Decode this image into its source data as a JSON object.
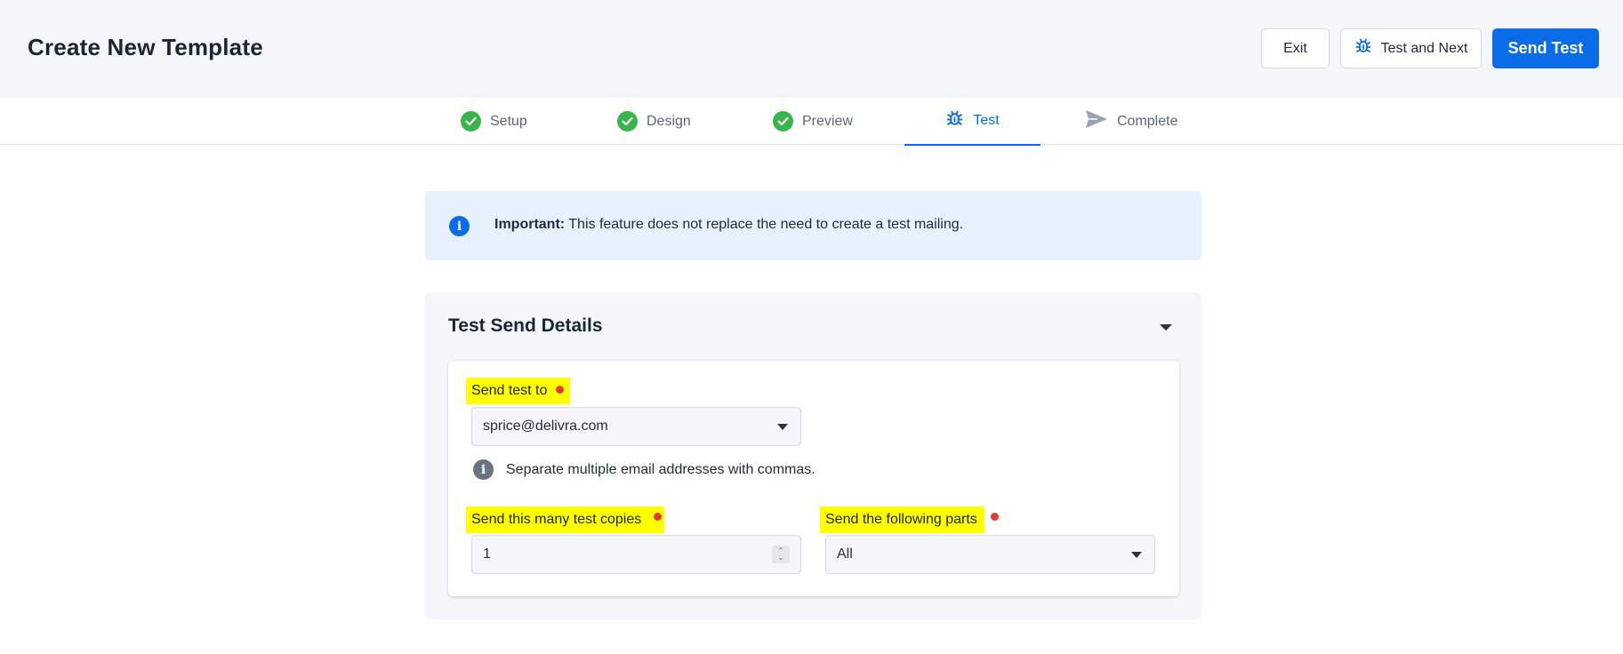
{
  "header": {
    "title": "Create New Template",
    "exit_label": "Exit",
    "test_next_label": "Test and Next",
    "send_test_label": "Send Test"
  },
  "steps": [
    {
      "label": "Setup",
      "icon": "check-circle-icon",
      "state": "complete"
    },
    {
      "label": "Design",
      "icon": "check-circle-icon",
      "state": "complete"
    },
    {
      "label": "Preview",
      "icon": "check-circle-icon",
      "state": "complete"
    },
    {
      "label": "Test",
      "icon": "bug-icon",
      "state": "active"
    },
    {
      "label": "Complete",
      "icon": "send-icon",
      "state": "pending"
    }
  ],
  "alert": {
    "strong": "Important:",
    "text": " This feature does not replace the need to create a test mailing."
  },
  "card": {
    "title": "Test Send Details",
    "send_to": {
      "label": "Send test to",
      "value": "sprice@delivra.com",
      "hint": "Separate multiple email addresses with commas."
    },
    "copies": {
      "label": "Send this many test copies",
      "value": "1"
    },
    "parts": {
      "label": "Send the following parts",
      "value": "All"
    }
  },
  "colors": {
    "accent": "#0a6ce6",
    "success": "#39b54a",
    "required": "#e53935",
    "highlight": "#ffff00"
  }
}
